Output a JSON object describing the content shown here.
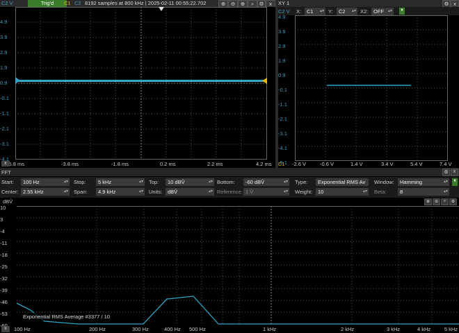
{
  "scope": {
    "ch_label": "C2 V",
    "trig_status": "Trig'd",
    "c1": "C1",
    "c2": "C2",
    "info": "8192 samples at 800 kHz | 2025-02-11 00:55:22.702",
    "y_ticks": [
      "4.9",
      "3.9",
      "2.9",
      "1.9",
      "0.9",
      "-0.1",
      "-1.1",
      "-2.1",
      "-3.1",
      "-4.1",
      "-5.1"
    ],
    "x_ticks": [
      "-5.8 ms",
      "-3.8 ms",
      "-1.8 ms",
      "0.2 ms",
      "2.2 ms",
      "4.2 ms"
    ],
    "close": "x"
  },
  "xy": {
    "title": "XY 1",
    "ch_label": "C2 V",
    "x_label": "X:",
    "x_value": "C1",
    "y_label": "Y:",
    "y_value": "C2",
    "x2_label": "X2:",
    "x2_value": "OFF",
    "y_ticks": [
      "4.9",
      "3.9",
      "2.9",
      "1.9",
      "0.9",
      "-0.1",
      "-1.1",
      "-2.1",
      "-3.1",
      "-4.1",
      "-5.1"
    ],
    "x_ticks": [
      "-2.6 V",
      "-0.6 V",
      "1.4 V",
      "3.4 V",
      "5.4 V",
      "7.4 V"
    ],
    "corner": "C1"
  },
  "fft": {
    "title": "FFT",
    "start_label": "Start:",
    "start_value": "100 Hz",
    "stop_label": "Stop:",
    "stop_value": "5 kHz",
    "top_label": "Top:",
    "top_value": "10 dBV̂",
    "bottom_label": "Bottom:",
    "bottom_value": "-60 dBV̂",
    "type_label": "Type:",
    "type_value": "Exponential RMS Av",
    "window_label": "Window:",
    "window_value": "Hamming",
    "center_label": "Center:",
    "center_value": "2.55 kHz",
    "span_label": "Span:",
    "span_value": "4.9 kHz",
    "units_label": "Units:",
    "units_value": "dBV̂",
    "reference_label": "Reference:",
    "reference_value": "1 V̂",
    "weight_label": "Weight:",
    "weight_value": "10",
    "beta_label": "Beta:",
    "beta_value": "8",
    "y_unit": "dBV̂",
    "y_ticks": [
      "10",
      "3",
      "-4",
      "-11",
      "-18",
      "-25",
      "-32",
      "-39",
      "-46",
      "-53",
      "-60"
    ],
    "x_ticks": [
      "100 Hz",
      "200 Hz",
      "300 Hz",
      "400 Hz",
      "500 Hz",
      "1 kHz",
      "2 kHz",
      "3 kHz",
      "4 kHz",
      "5 kHz"
    ],
    "average_text": "Exponential RMS Average #3377 / 10",
    "close": "x"
  }
}
